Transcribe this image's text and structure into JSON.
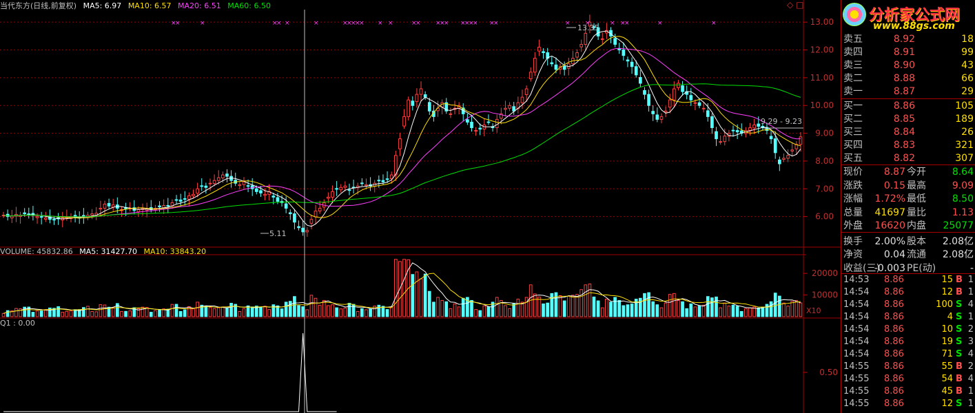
{
  "legend": {
    "title": "当代东方(日线,前复权)",
    "ma5": "MA5: 6.97",
    "ma10": "MA10: 6.57",
    "ma20": "MA20: 6.51",
    "ma60": "MA60: 6.50"
  },
  "volume_legend": {
    "label": "VOLUME: 45832.86",
    "ma5": "MA5: 31427.70",
    "ma10": "MA10: 33843.20"
  },
  "indicator_legend": {
    "label": "Q1 : 0.00"
  },
  "annotations": {
    "high": "13.35",
    "low": "5.11",
    "last": "9.29 - 9.23",
    "multiplier": "X10"
  },
  "price_axis": [
    "13.00",
    "12.00",
    "11.00",
    "10.00",
    "9.00",
    "8.00",
    "7.00",
    "6.00"
  ],
  "volume_axis": [
    "20000",
    "10000"
  ],
  "indicator_axis": [
    "0.50"
  ],
  "colors": {
    "up": "#ff4040",
    "down": "#54ffff",
    "ma5": "#ffffff",
    "ma10": "#ffe000",
    "ma20": "#ff40ff",
    "ma60": "#00e000",
    "grid": "#a00000"
  },
  "logo": {
    "name": "分析家公式网",
    "url": "www.88gs.com"
  },
  "orderbook": {
    "asks": [
      {
        "label": "卖五",
        "price": "8.92",
        "vol": "18"
      },
      {
        "label": "卖四",
        "price": "8.91",
        "vol": "99"
      },
      {
        "label": "卖三",
        "price": "8.90",
        "vol": "43"
      },
      {
        "label": "卖二",
        "price": "8.88",
        "vol": "66"
      },
      {
        "label": "卖一",
        "price": "8.87",
        "vol": "29"
      }
    ],
    "bids": [
      {
        "label": "买一",
        "price": "8.86",
        "vol": "105"
      },
      {
        "label": "买二",
        "price": "8.85",
        "vol": "189"
      },
      {
        "label": "买三",
        "price": "8.84",
        "vol": "26"
      },
      {
        "label": "买四",
        "price": "8.83",
        "vol": "321"
      },
      {
        "label": "买五",
        "price": "8.82",
        "vol": "307"
      }
    ]
  },
  "quote": [
    {
      "l1": "现价",
      "v1": "8.87",
      "c1": "red",
      "l2": "今开",
      "v2": "8.64",
      "c2": "green"
    },
    {
      "l1": "涨跌",
      "v1": "0.15",
      "c1": "red",
      "l2": "最高",
      "v2": "9.09",
      "c2": "red"
    },
    {
      "l1": "涨幅",
      "v1": "1.72%",
      "c1": "red",
      "l2": "最低",
      "v2": "8.50",
      "c2": "green"
    },
    {
      "l1": "总量",
      "v1": "41697",
      "c1": "yellow",
      "l2": "量比",
      "v2": "1.13",
      "c2": "red"
    },
    {
      "l1": "外盘",
      "v1": "16620",
      "c1": "red",
      "l2": "内盘",
      "v2": "25077",
      "c2": "green"
    },
    {
      "l1": "换手",
      "v1": "2.00%",
      "c1": "white",
      "l2": "股本",
      "v2": "2.08亿",
      "c2": "white"
    },
    {
      "l1": "净资",
      "v1": "0.04",
      "c1": "white",
      "l2": "流通",
      "v2": "2.08亿",
      "c2": "white"
    },
    {
      "l1": "收益(三)",
      "v1": "-0.003",
      "c1": "white",
      "l2": "PE(动)",
      "v2": "-",
      "c2": "white"
    }
  ],
  "ticks": [
    {
      "time": "14:53",
      "price": "8.86",
      "vol": "15",
      "side": "B",
      "n": "1"
    },
    {
      "time": "14:54",
      "price": "8.86",
      "vol": "12",
      "side": "B",
      "n": "1"
    },
    {
      "time": "14:54",
      "price": "8.86",
      "vol": "100",
      "side": "S",
      "n": "4"
    },
    {
      "time": "14:54",
      "price": "8.86",
      "vol": "4",
      "side": "S",
      "n": "1"
    },
    {
      "time": "14:54",
      "price": "8.86",
      "vol": "10",
      "side": "S",
      "n": "2"
    },
    {
      "time": "14:54",
      "price": "8.86",
      "vol": "19",
      "side": "S",
      "n": "3"
    },
    {
      "time": "14:54",
      "price": "8.86",
      "vol": "71",
      "side": "S",
      "n": "4"
    },
    {
      "time": "14:55",
      "price": "8.86",
      "vol": "55",
      "side": "B",
      "n": "2"
    },
    {
      "time": "14:55",
      "price": "8.86",
      "vol": "54",
      "side": "B",
      "n": "4"
    },
    {
      "time": "14:55",
      "price": "8.86",
      "vol": "45",
      "side": "B",
      "n": "1"
    },
    {
      "time": "14:55",
      "price": "8.86",
      "vol": "12",
      "side": "S",
      "n": "1"
    }
  ],
  "chart_data": {
    "type": "candlestick",
    "ylim": [
      5.0,
      13.5
    ],
    "closes": [
      6.05,
      6.0,
      6.02,
      6.08,
      6.05,
      6.1,
      6.07,
      6.04,
      6.0,
      5.98,
      5.95,
      5.9,
      5.88,
      5.92,
      5.95,
      5.98,
      6.0,
      5.97,
      5.96,
      6.0,
      6.05,
      6.1,
      6.12,
      6.3,
      6.45,
      6.38,
      6.42,
      6.3,
      6.25,
      6.28,
      6.3,
      6.22,
      6.25,
      6.3,
      6.28,
      6.25,
      6.3,
      6.35,
      6.4,
      6.38,
      6.5,
      6.6,
      6.55,
      6.62,
      6.75,
      6.8,
      7.0,
      7.1,
      7.05,
      7.2,
      7.3,
      7.4,
      7.5,
      7.45,
      7.3,
      7.2,
      7.15,
      7.25,
      7.1,
      7.0,
      6.9,
      6.85,
      6.8,
      6.9,
      6.7,
      6.55,
      6.5,
      6.3,
      6.1,
      5.8,
      5.6,
      5.45,
      5.5,
      5.9,
      6.2,
      6.3,
      6.5,
      6.7,
      6.9,
      7.0,
      7.05,
      7.1,
      6.95,
      7.05,
      7.1,
      7.2,
      7.15,
      7.1,
      7.2,
      7.3,
      7.25,
      7.35,
      7.5,
      8.2,
      8.8,
      9.6,
      10.2,
      10.0,
      10.4,
      10.6,
      10.3,
      9.8,
      9.6,
      9.9,
      10.1,
      9.8,
      9.7,
      9.9,
      10.0,
      9.7,
      9.4,
      9.2,
      9.1,
      9.15,
      9.3,
      9.4,
      9.2,
      9.5,
      9.7,
      9.9,
      10.0,
      9.8,
      10.1,
      10.3,
      10.6,
      11.2,
      11.7,
      12.1,
      11.9,
      11.7,
      11.5,
      11.3,
      11.4,
      11.3,
      11.5,
      11.7,
      11.9,
      12.2,
      12.6,
      13.0,
      12.8,
      12.5,
      12.4,
      12.7,
      12.5,
      12.2,
      12.0,
      11.8,
      11.6,
      11.4,
      11.1,
      10.8,
      10.4,
      10.0,
      9.7,
      9.5,
      9.6,
      9.8,
      10.2,
      10.6,
      10.8,
      10.5,
      10.4,
      10.2,
      10.1,
      10.0,
      9.9,
      9.6,
      9.2,
      8.8,
      8.7,
      8.9,
      9.0,
      9.1,
      9.05,
      9.0,
      9.1,
      9.2,
      9.3,
      9.25,
      9.2,
      9.1,
      8.8,
      8.3,
      7.9,
      8.1,
      8.2,
      8.4,
      8.6,
      8.87
    ],
    "volume_ylim": [
      0,
      28000
    ],
    "q1": [
      0,
      0,
      0,
      0,
      0,
      0,
      0,
      0,
      0,
      0,
      0,
      0,
      0,
      0,
      0,
      0,
      0,
      0,
      0,
      0,
      0,
      0,
      0,
      0,
      0,
      0,
      0,
      0,
      0,
      0,
      0,
      0,
      0,
      0,
      0,
      0,
      0,
      0,
      0,
      0,
      0,
      0,
      0,
      0,
      0,
      0,
      0,
      0,
      0,
      0,
      0,
      0,
      0,
      0,
      0,
      0,
      0,
      0,
      0,
      0,
      0,
      0,
      0,
      0,
      0,
      0,
      0,
      0,
      0,
      0,
      0,
      1,
      0,
      0,
      0,
      0,
      0,
      0,
      0,
      0
    ]
  }
}
